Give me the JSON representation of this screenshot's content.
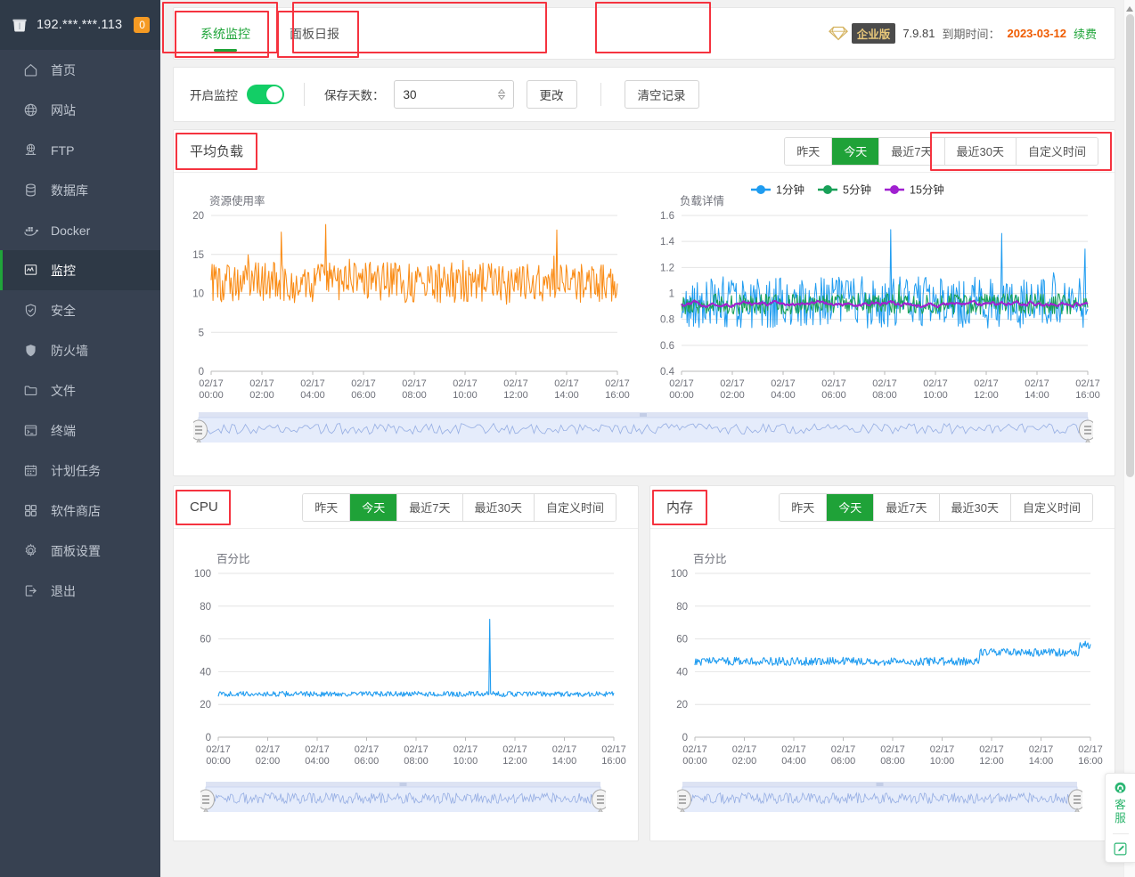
{
  "sidebar": {
    "server_ip": "192.***.***.113",
    "notification_count": "0",
    "items": [
      {
        "label": "首页",
        "icon": "home-icon"
      },
      {
        "label": "网站",
        "icon": "globe-icon"
      },
      {
        "label": "FTP",
        "icon": "ftp-icon"
      },
      {
        "label": "数据库",
        "icon": "database-icon"
      },
      {
        "label": "Docker",
        "icon": "docker-icon"
      },
      {
        "label": "监控",
        "icon": "monitor-icon"
      },
      {
        "label": "安全",
        "icon": "shield-check-icon"
      },
      {
        "label": "防火墙",
        "icon": "firewall-icon"
      },
      {
        "label": "文件",
        "icon": "folder-icon"
      },
      {
        "label": "终端",
        "icon": "terminal-icon"
      },
      {
        "label": "计划任务",
        "icon": "calendar-icon"
      },
      {
        "label": "软件商店",
        "icon": "grid-icon"
      },
      {
        "label": "面板设置",
        "icon": "gear-icon"
      },
      {
        "label": "退出",
        "icon": "logout-icon"
      }
    ],
    "active_index": 5
  },
  "header": {
    "tabs": [
      {
        "label": "系统监控",
        "active": true
      },
      {
        "label": "面板日报",
        "active": false
      }
    ],
    "edition_label": "企业版",
    "version": "7.9.81",
    "expire_label": "到期时间：",
    "expire_date": "2023-03-12",
    "renew_label": "续费"
  },
  "controls": {
    "monitor_toggle_label": "开启监控",
    "monitor_toggle_on": true,
    "save_days_label": "保存天数：",
    "save_days_value": "30",
    "change_button": "更改",
    "clear_button": "清空记录"
  },
  "range_options": [
    "昨天",
    "今天",
    "最近7天",
    "最近30天",
    "自定义时间"
  ],
  "range_active": "今天",
  "panels": {
    "load": {
      "title": "平均负载",
      "left_chart_label": "资源使用率",
      "right_chart_label": "负载详情",
      "legend": [
        "1分钟",
        "5分钟",
        "15分钟"
      ]
    },
    "cpu": {
      "title": "CPU",
      "chart_label": "百分比"
    },
    "memory": {
      "title": "内存",
      "chart_label": "百分比"
    }
  },
  "service_widget": {
    "label": "客服",
    "icons": [
      "headset-icon",
      "pencil-icon"
    ]
  },
  "colors": {
    "accent_green": "#20a53a",
    "toggle_green": "#13ce66",
    "orange_series": "#fa8c16",
    "blue_series": "#1f9cf0",
    "green_series": "#18a058",
    "purple_series": "#a020d0",
    "expire_orange": "#ef5b00",
    "badge_orange": "#f59a23",
    "annotation_red": "#f5333f",
    "sidebar_bg": "#374151"
  },
  "chart_data": [
    {
      "id": "load-usage",
      "type": "line",
      "title": "资源使用率",
      "xlabel": "",
      "ylabel": "",
      "ylim": [
        0,
        20
      ],
      "yticks": [
        0,
        5,
        10,
        15,
        20
      ],
      "xticks": [
        "02/17 00:00",
        "02/17 02:00",
        "02/17 04:00",
        "02/17 06:00",
        "02/17 08:00",
        "02/17 10:00",
        "02/17 12:00",
        "02/17 14:00",
        "02/17 16:00"
      ],
      "grid": true,
      "legend": [],
      "series": [
        {
          "name": "资源使用率",
          "color": "#fa8c16",
          "mean": 11.5,
          "min": 6.4,
          "max": 17.8,
          "values": [
            17.8,
            9.2,
            11.3,
            12.6,
            10.1,
            14.9,
            11.2,
            8.6,
            12.4,
            10.8,
            13.9,
            9.4,
            11.7,
            14.2,
            10.3,
            12.1,
            8.9,
            11.4,
            13.2,
            10.6,
            12.8,
            9.7,
            16.8,
            11.2,
            8.1,
            12.9,
            10.4,
            13.6,
            9.1,
            11.8,
            16.7,
            10.2,
            12.3,
            9.6,
            13.1,
            11.5,
            8.8,
            12.7,
            10.9,
            15.2,
            11.1,
            9.3,
            13.4,
            10.7,
            15.1,
            11.9,
            8.4,
            12.2,
            14.6,
            10.5,
            12.0,
            9.0,
            11.6,
            13.8,
            6.7,
            11.3,
            12.5,
            10.2,
            13.0,
            9.5,
            11.8,
            12.9,
            10.1,
            13.5,
            9.8,
            12.4,
            7.2,
            11.0,
            12.6,
            6.4,
            11.7,
            13.3,
            10.4,
            16.0,
            12.1,
            9.9,
            11.5,
            15.1,
            10.8,
            12.2,
            9.4,
            13.7,
            11.0,
            15.4,
            12.3,
            9.2,
            11.6,
            13.1,
            10.5,
            15.1,
            12.8,
            9.6,
            11.9,
            13.4,
            10.0,
            12.5,
            17.6,
            11.2,
            9.7,
            13.0,
            12.1,
            10.3,
            15.8,
            11.4,
            9.1,
            12.7,
            15.5,
            10.6,
            13.2,
            11.8,
            8.3,
            12.0,
            14.2,
            10.9,
            13.6,
            11.3,
            9.5,
            12.4,
            15.3,
            11.1,
            14.8,
            12.6,
            10.2,
            13.1,
            9.3,
            11.7,
            12.9,
            10.8,
            14.6,
            11.4,
            17.2,
            12.2,
            9.9,
            13.5,
            15.3,
            11.0,
            12.7,
            10.4,
            13.8,
            11.6,
            9.1,
            12.3,
            15.4,
            11.8,
            10.0,
            13.2,
            7.2,
            11.5,
            14.0,
            12.1,
            9.6,
            13.4,
            10.7,
            14.9,
            11.9,
            12.4,
            10.1,
            12.8,
            11.2
          ]
        }
      ]
    },
    {
      "id": "load-detail",
      "type": "line",
      "title": "负载详情",
      "xlabel": "",
      "ylabel": "",
      "ylim": [
        0.4,
        1.6
      ],
      "yticks": [
        0.4,
        0.6,
        0.8,
        1,
        1.2,
        1.4,
        1.6
      ],
      "xticks": [
        "02/17 00:00",
        "02/17 02:00",
        "02/17 04:00",
        "02/17 06:00",
        "02/17 08:00",
        "02/17 10:00",
        "02/17 12:00",
        "02/17 14:00",
        "02/17 16:00"
      ],
      "grid": true,
      "legend": [
        "1分钟",
        "5分钟",
        "15分钟"
      ],
      "legend_position": "top",
      "series": [
        {
          "name": "1分钟",
          "color": "#1f9cf0",
          "mean": 0.93,
          "min": 0.52,
          "max": 1.41
        },
        {
          "name": "5分钟",
          "color": "#18a058",
          "mean": 0.92,
          "min": 0.74,
          "max": 1.08
        },
        {
          "name": "15分钟",
          "color": "#a020d0",
          "mean": 0.92,
          "min": 0.83,
          "max": 1.0
        }
      ]
    },
    {
      "id": "cpu",
      "type": "line",
      "title": "CPU",
      "xlabel": "",
      "ylabel": "百分比",
      "ylim": [
        0,
        100
      ],
      "yticks": [
        0,
        20,
        40,
        60,
        80,
        100
      ],
      "xticks": [
        "02/17 00:00",
        "02/17 02:00",
        "02/17 04:00",
        "02/17 06:00",
        "02/17 08:00",
        "02/17 10:00",
        "02/17 12:00",
        "02/17 14:00",
        "02/17 16:00"
      ],
      "grid": true,
      "legend": [],
      "series": [
        {
          "name": "CPU",
          "color": "#1f9cf0",
          "mean": 26.5,
          "min": 24.5,
          "max": 72,
          "spike_at": "02/17 11:00",
          "spike_value": 72
        }
      ]
    },
    {
      "id": "memory",
      "type": "line",
      "title": "内存",
      "xlabel": "",
      "ylabel": "百分比",
      "ylim": [
        0,
        100
      ],
      "yticks": [
        0,
        20,
        40,
        60,
        80,
        100
      ],
      "xticks": [
        "02/17 00:00",
        "02/17 02:00",
        "02/17 04:00",
        "02/17 06:00",
        "02/17 08:00",
        "02/17 10:00",
        "02/17 12:00",
        "02/17 14:00",
        "02/17 16:00"
      ],
      "grid": true,
      "legend": [],
      "series": [
        {
          "name": "内存",
          "color": "#1f9cf0",
          "mean": 47,
          "min": 42,
          "max": 61
        }
      ]
    }
  ]
}
